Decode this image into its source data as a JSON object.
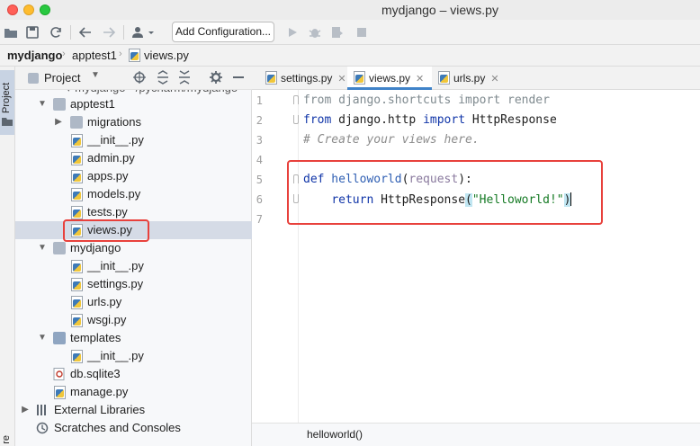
{
  "window": {
    "title": "mydjango – views.py"
  },
  "toolbar": {
    "add_configuration": "Add Configuration..."
  },
  "breadcrumb": {
    "project": "mydjango",
    "folder": "apptest1",
    "file": "views.py"
  },
  "side_stripe": {
    "project_tab": "Project",
    "bottom_tab": "re"
  },
  "project_panel": {
    "title": "Project"
  },
  "tree": [
    {
      "label": "apptest1",
      "kind": "folder",
      "depth": 1,
      "expanded": true
    },
    {
      "label": "migrations",
      "kind": "folder",
      "depth": 2,
      "expanded": false
    },
    {
      "label": "__init__.py",
      "kind": "py",
      "depth": 2
    },
    {
      "label": "admin.py",
      "kind": "py",
      "depth": 2
    },
    {
      "label": "apps.py",
      "kind": "py",
      "depth": 2
    },
    {
      "label": "models.py",
      "kind": "py",
      "depth": 2
    },
    {
      "label": "tests.py",
      "kind": "py",
      "depth": 2
    },
    {
      "label": "views.py",
      "kind": "py",
      "depth": 2,
      "selected": true
    },
    {
      "label": "mydjango",
      "kind": "folder",
      "depth": 1,
      "expanded": true
    },
    {
      "label": "__init__.py",
      "kind": "py",
      "depth": 2
    },
    {
      "label": "settings.py",
      "kind": "py",
      "depth": 2
    },
    {
      "label": "urls.py",
      "kind": "py",
      "depth": 2
    },
    {
      "label": "wsgi.py",
      "kind": "py",
      "depth": 2
    },
    {
      "label": "templates",
      "kind": "folder-blue",
      "depth": 1,
      "expanded": true
    },
    {
      "label": "__init__.py",
      "kind": "py",
      "depth": 2
    },
    {
      "label": "db.sqlite3",
      "kind": "db",
      "depth": 1
    },
    {
      "label": "manage.py",
      "kind": "py",
      "depth": 1
    },
    {
      "label": "External Libraries",
      "kind": "lib",
      "depth": 0,
      "expanded": false
    },
    {
      "label": "Scratches and Consoles",
      "kind": "scratch",
      "depth": 0
    }
  ],
  "editor_tabs": [
    {
      "label": "settings.py",
      "active": false
    },
    {
      "label": "views.py",
      "active": true
    },
    {
      "label": "urls.py",
      "active": false
    }
  ],
  "code": {
    "line_numbers": [
      "1",
      "2",
      "3",
      "4",
      "5",
      "6",
      "7"
    ],
    "l1_from": "from",
    "l1_mod": " django.shortcuts ",
    "l1_import": "import",
    "l1_name": " render",
    "l2_from": "from",
    "l2_mod": " django.http ",
    "l2_import": "import",
    "l2_name": " HttpResponse",
    "l3_comment": "# Create your views here.",
    "l5_def": "def",
    "l5_fn": " helloworld",
    "l5_open": "(",
    "l5_param": "request",
    "l5_close": "):",
    "l6_indent": "    ",
    "l6_return": "return",
    "l6_call": " HttpResponse",
    "l6_open": "(",
    "l6_str": "\"Helloworld!\"",
    "l6_close": ")"
  },
  "status": {
    "breadcrumb_function": "helloworld()"
  },
  "colors": {
    "highlight": "#e8413c",
    "accent": "#4083c9",
    "selection": "#d5dbe6"
  }
}
